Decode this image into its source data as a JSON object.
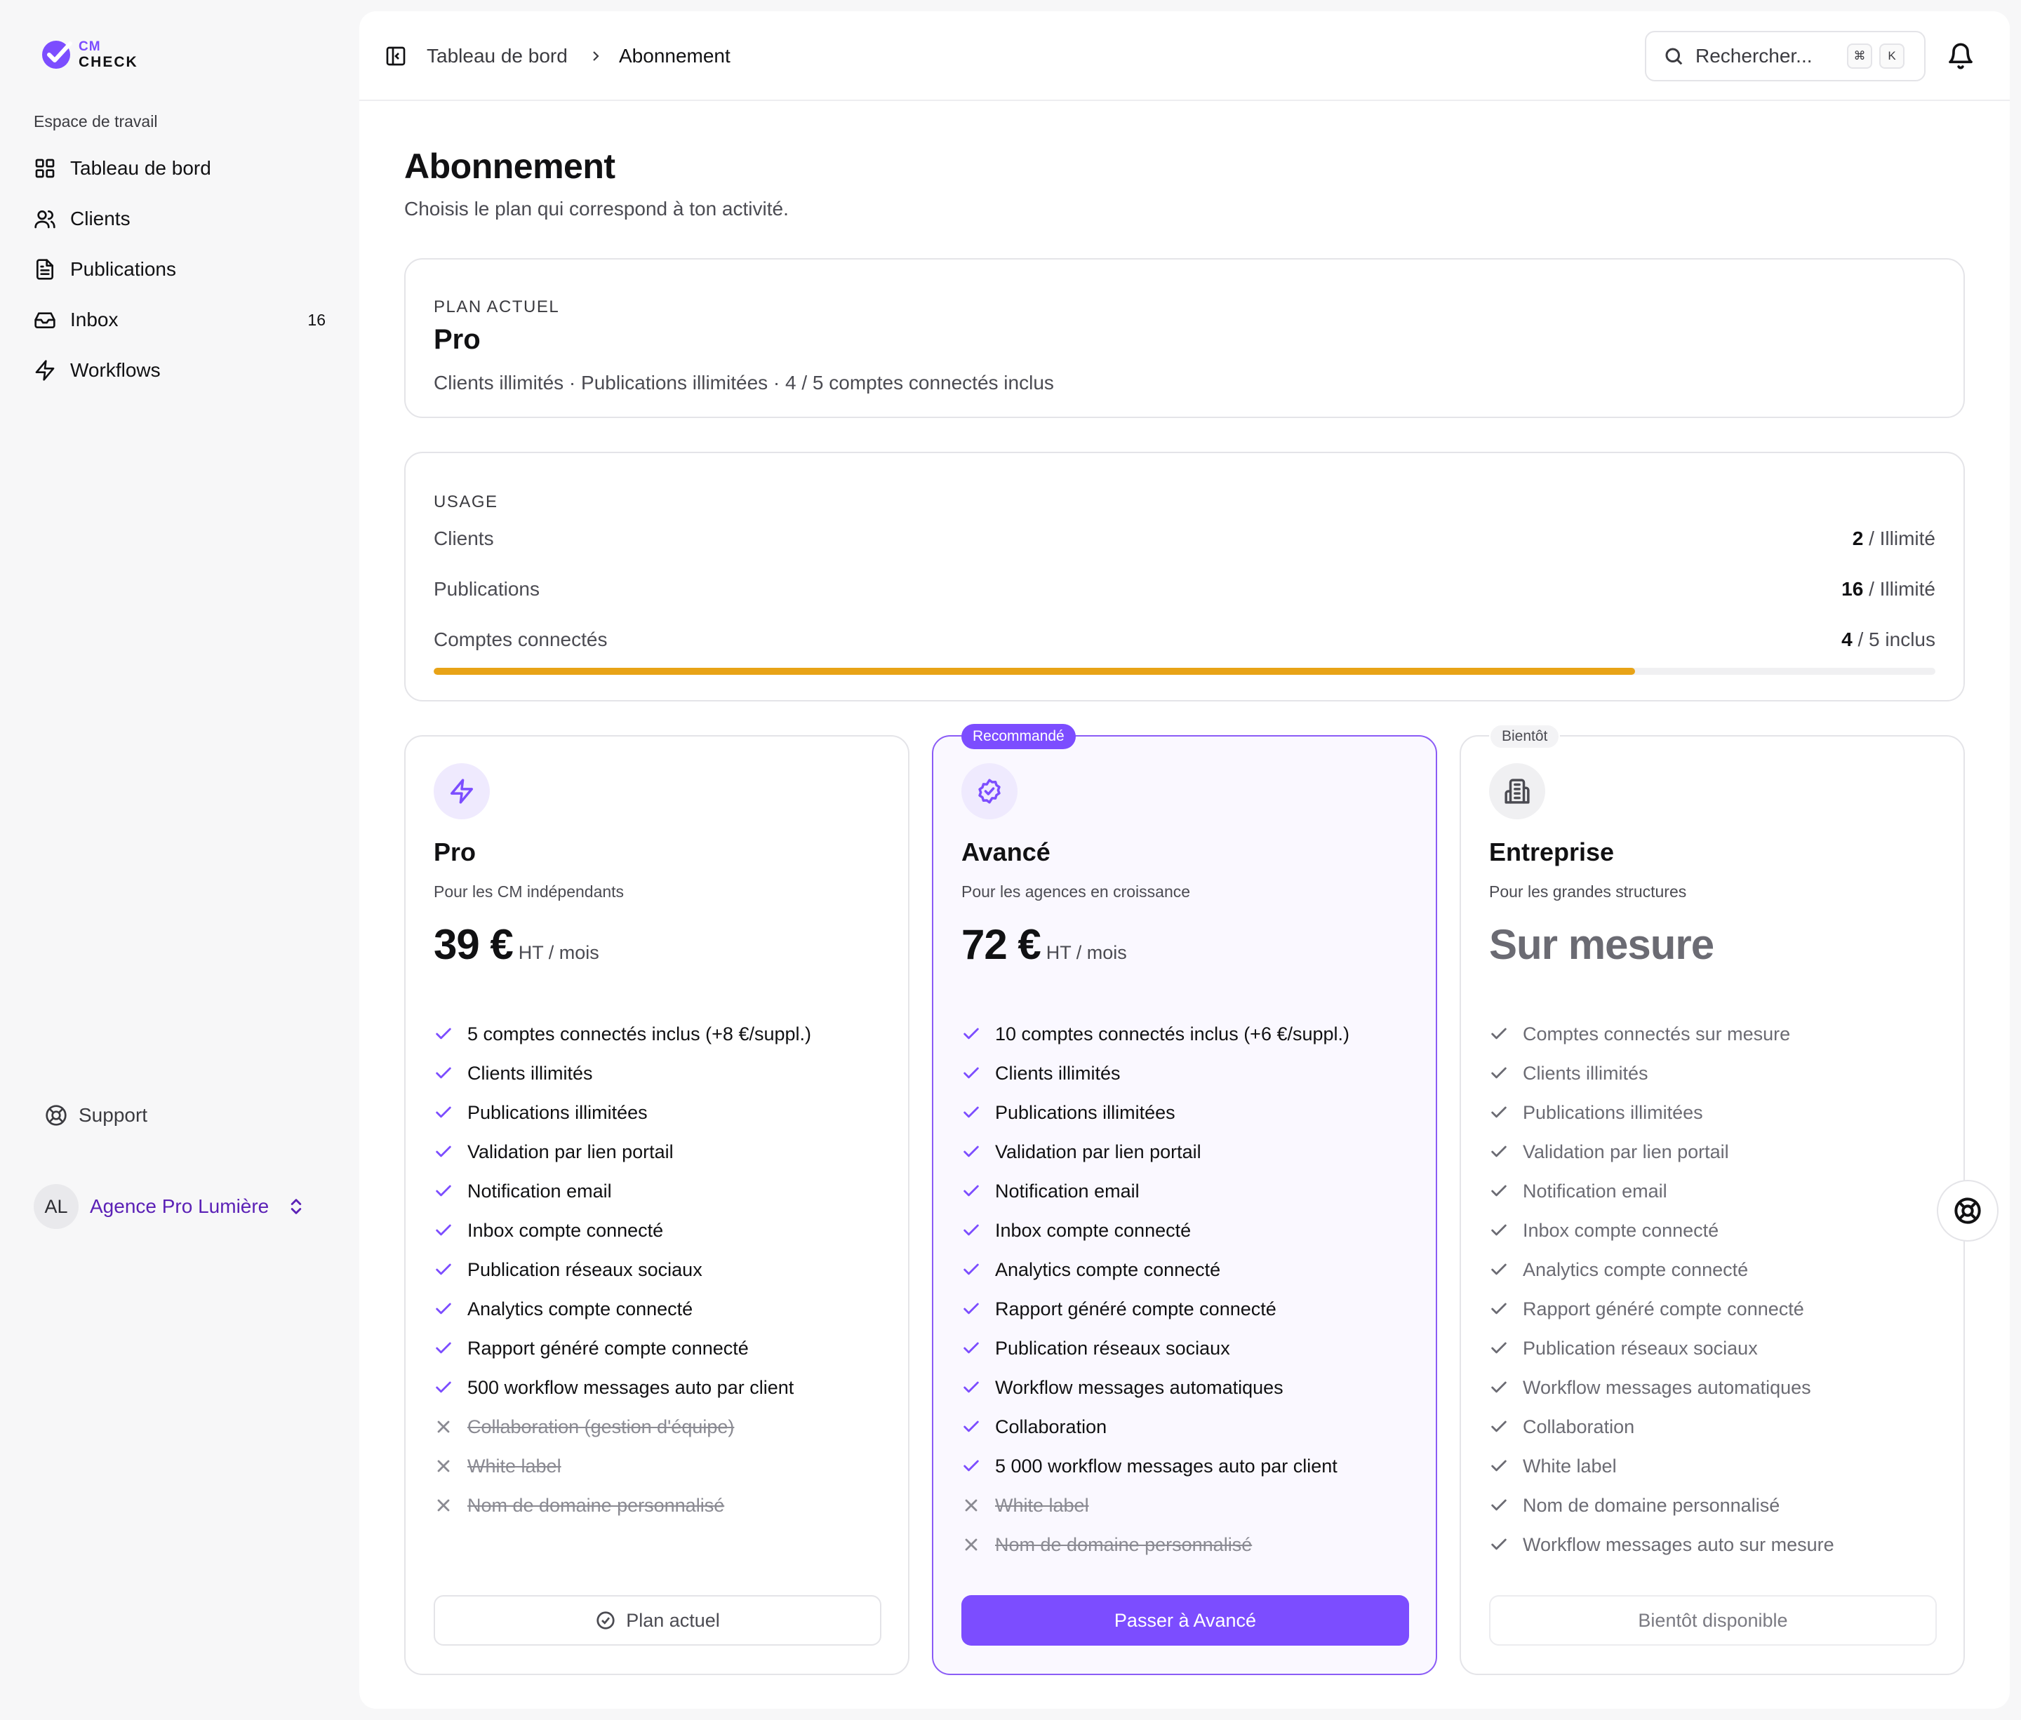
{
  "brand": {
    "line1": "CM",
    "line2": "CHECK",
    "accent": "#7c4dff"
  },
  "sidebar": {
    "section_label": "Espace de travail",
    "items": [
      {
        "label": "Tableau de bord",
        "icon": "grid-icon"
      },
      {
        "label": "Clients",
        "icon": "users-icon"
      },
      {
        "label": "Publications",
        "icon": "document-icon"
      },
      {
        "label": "Inbox",
        "icon": "inbox-icon",
        "count": "16"
      },
      {
        "label": "Workflows",
        "icon": "lightning-icon"
      }
    ],
    "support_label": "Support",
    "account": {
      "initials": "AL",
      "name": "Agence Pro Lumière"
    }
  },
  "header": {
    "breadcrumb": [
      "Tableau de bord",
      "Abonnement"
    ],
    "search_placeholder": "Rechercher...",
    "shortcut": [
      "⌘",
      "K"
    ]
  },
  "page": {
    "title": "Abonnement",
    "subtitle": "Choisis le plan qui correspond à ton activité."
  },
  "current_plan": {
    "label": "PLAN ACTUEL",
    "name": "Pro",
    "description": "Clients illimités · Publications illimitées · 4 / 5 comptes connectés inclus"
  },
  "usage": {
    "label": "USAGE",
    "rows": [
      {
        "label": "Clients",
        "value": "2",
        "limit": " / Illimité"
      },
      {
        "label": "Publications",
        "value": "16",
        "limit": " / Illimité"
      },
      {
        "label": "Comptes connectés",
        "value": "4",
        "limit": " / 5 inclus"
      }
    ],
    "connected_progress": 0.8,
    "progress_color": "#e8a317"
  },
  "plans": [
    {
      "name": "Pro",
      "audience": "Pour les CM indépendants",
      "price": "39 €",
      "price_unit": "HT / mois",
      "features": [
        {
          "text": "5 comptes connectés inclus (+8 €/suppl.)",
          "included": true
        },
        {
          "text": "Clients illimités",
          "included": true
        },
        {
          "text": "Publications illimitées",
          "included": true
        },
        {
          "text": "Validation par lien portail",
          "included": true
        },
        {
          "text": "Notification email",
          "included": true
        },
        {
          "text": "Inbox compte connecté",
          "included": true
        },
        {
          "text": "Publication réseaux sociaux",
          "included": true
        },
        {
          "text": "Analytics compte connecté",
          "included": true
        },
        {
          "text": "Rapport généré compte connecté",
          "included": true
        },
        {
          "text": "500 workflow messages auto par client",
          "included": true
        },
        {
          "text": "Collaboration (gestion d'équipe)",
          "included": false
        },
        {
          "text": "White label",
          "included": false
        },
        {
          "text": "Nom de domaine personnalisé",
          "included": false
        }
      ],
      "button": "Plan actuel"
    },
    {
      "badge": "Recommandé",
      "name": "Avancé",
      "audience": "Pour les agences en croissance",
      "price": "72 €",
      "price_unit": "HT / mois",
      "features": [
        {
          "text": "10 comptes connectés inclus (+6 €/suppl.)",
          "included": true
        },
        {
          "text": "Clients illimités",
          "included": true
        },
        {
          "text": "Publications illimitées",
          "included": true
        },
        {
          "text": "Validation par lien portail",
          "included": true
        },
        {
          "text": "Notification email",
          "included": true
        },
        {
          "text": "Inbox compte connecté",
          "included": true
        },
        {
          "text": "Analytics compte connecté",
          "included": true
        },
        {
          "text": "Rapport généré compte connecté",
          "included": true
        },
        {
          "text": "Publication réseaux sociaux",
          "included": true
        },
        {
          "text": "Workflow messages automatiques",
          "included": true
        },
        {
          "text": "Collaboration",
          "included": true
        },
        {
          "text": "5 000 workflow messages auto par client",
          "included": true
        },
        {
          "text": "White label",
          "included": false
        },
        {
          "text": "Nom de domaine personnalisé",
          "included": false
        }
      ],
      "button": "Passer à Avancé"
    },
    {
      "badge": "Bientôt",
      "name": "Entreprise",
      "audience": "Pour les grandes structures",
      "price": "Sur mesure",
      "features": [
        {
          "text": "Comptes connectés sur mesure",
          "included": true
        },
        {
          "text": "Clients illimités",
          "included": true
        },
        {
          "text": "Publications illimitées",
          "included": true
        },
        {
          "text": "Validation par lien portail",
          "included": true
        },
        {
          "text": "Notification email",
          "included": true
        },
        {
          "text": "Inbox compte connecté",
          "included": true
        },
        {
          "text": "Analytics compte connecté",
          "included": true
        },
        {
          "text": "Rapport généré compte connecté",
          "included": true
        },
        {
          "text": "Publication réseaux sociaux",
          "included": true
        },
        {
          "text": "Workflow messages automatiques",
          "included": true
        },
        {
          "text": "Collaboration",
          "included": true
        },
        {
          "text": "White label",
          "included": true
        },
        {
          "text": "Nom de domaine personnalisé",
          "included": true
        },
        {
          "text": "Workflow messages auto sur mesure",
          "included": true
        }
      ],
      "button": "Bientôt disponible"
    }
  ]
}
